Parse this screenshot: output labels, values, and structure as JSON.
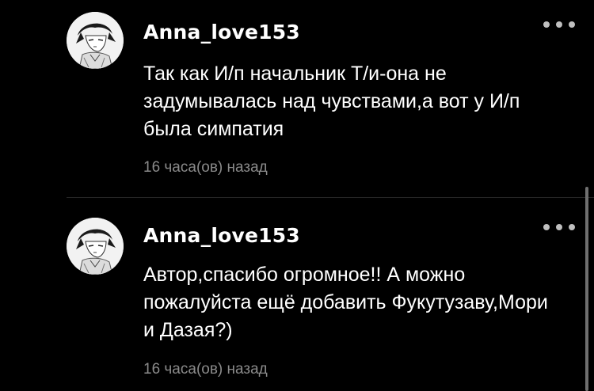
{
  "comments": [
    {
      "username": "Anna_love153",
      "avatar": "manga-character-avatar",
      "more_icon": "more-horizontal-icon",
      "text": "Так как И/п начальник Т/и-она не задумывалась над чувствами,а вот у И/п была симпатия",
      "time": "16 часа(ов) назад"
    },
    {
      "username": "Anna_love153",
      "avatar": "manga-character-avatar",
      "more_icon": "more-horizontal-icon",
      "text": "Автор,спасибо огромное!! А можно пожалуйста ещё добавить Фукутузаву,Мори и Дазая?)",
      "time": "16 часа(ов) назад"
    }
  ],
  "colors": {
    "background": "#000000",
    "text": "#ffffff",
    "secondary_text": "#8a8a8a",
    "divider": "#262626",
    "more_dots": "#bfbfbf"
  }
}
